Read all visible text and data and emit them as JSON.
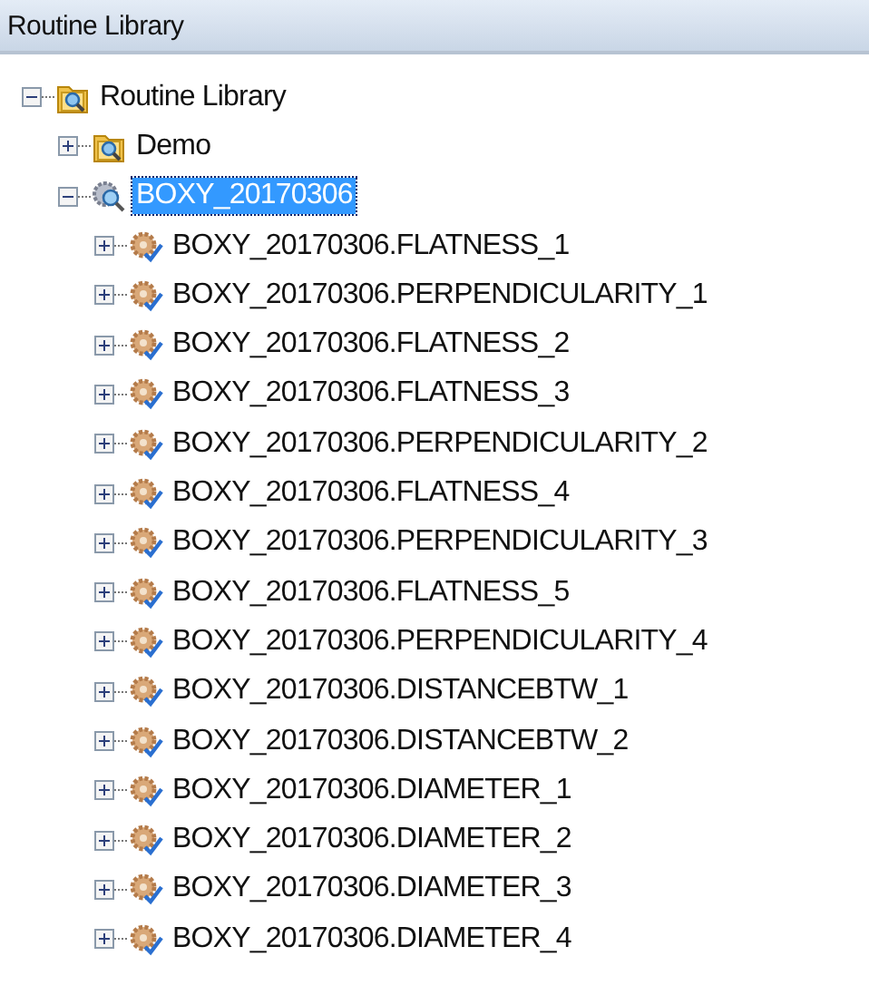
{
  "panel": {
    "title": "Routine Library"
  },
  "tree": [
    {
      "label": "Routine Library",
      "kind": "folder",
      "expanded": true,
      "selected": false,
      "children": [
        {
          "label": "Demo",
          "kind": "folder",
          "expanded": false,
          "selected": false
        },
        {
          "label": "BOXY_20170306",
          "kind": "routine-set",
          "expanded": true,
          "selected": true,
          "children": [
            {
              "label": "BOXY_20170306.FLATNESS_1",
              "kind": "routine",
              "expanded": false,
              "selected": false
            },
            {
              "label": "BOXY_20170306.PERPENDICULARITY_1",
              "kind": "routine",
              "expanded": false,
              "selected": false
            },
            {
              "label": "BOXY_20170306.FLATNESS_2",
              "kind": "routine",
              "expanded": false,
              "selected": false
            },
            {
              "label": "BOXY_20170306.FLATNESS_3",
              "kind": "routine",
              "expanded": false,
              "selected": false
            },
            {
              "label": "BOXY_20170306.PERPENDICULARITY_2",
              "kind": "routine",
              "expanded": false,
              "selected": false
            },
            {
              "label": "BOXY_20170306.FLATNESS_4",
              "kind": "routine",
              "expanded": false,
              "selected": false
            },
            {
              "label": "BOXY_20170306.PERPENDICULARITY_3",
              "kind": "routine",
              "expanded": false,
              "selected": false
            },
            {
              "label": "BOXY_20170306.FLATNESS_5",
              "kind": "routine",
              "expanded": false,
              "selected": false
            },
            {
              "label": "BOXY_20170306.PERPENDICULARITY_4",
              "kind": "routine",
              "expanded": false,
              "selected": false
            },
            {
              "label": "BOXY_20170306.DISTANCEBTW_1",
              "kind": "routine",
              "expanded": false,
              "selected": false
            },
            {
              "label": "BOXY_20170306.DISTANCEBTW_2",
              "kind": "routine",
              "expanded": false,
              "selected": false
            },
            {
              "label": "BOXY_20170306.DIAMETER_1",
              "kind": "routine",
              "expanded": false,
              "selected": false
            },
            {
              "label": "BOXY_20170306.DIAMETER_2",
              "kind": "routine",
              "expanded": false,
              "selected": false
            },
            {
              "label": "BOXY_20170306.DIAMETER_3",
              "kind": "routine",
              "expanded": false,
              "selected": false
            },
            {
              "label": "BOXY_20170306.DIAMETER_4",
              "kind": "routine",
              "expanded": false,
              "selected": false
            }
          ]
        }
      ]
    }
  ]
}
